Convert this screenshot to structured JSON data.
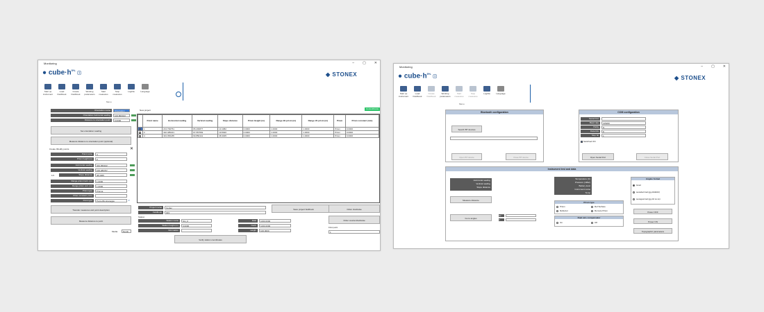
{
  "w1": {
    "title": "Monitoring",
    "logo": "cube·h",
    "logo_super": "5%",
    "brand": "STONEX",
    "ribbon": [
      {
        "label": "Start up instrument"
      },
      {
        "label": "Load Fieldbook"
      },
      {
        "label": "Create Fieldbook"
      },
      {
        "label": "Working parameters"
      },
      {
        "label": "Start measures"
      },
      {
        "label": "Stop measures"
      },
      {
        "label": "LogFile"
      },
      {
        "label": "Language"
      }
    ],
    "menu_label": "Menu",
    "left_fields": [
      {
        "label": "Orientation name",
        "value": "Orientation"
      },
      {
        "label": "Orientation horizontal reading",
        "value": "100.800013"
      },
      {
        "label": "Distance to orientation point",
        "value": "0.0000"
      }
    ],
    "set_orient_btn": "Set orientation reading",
    "measure_orient_btn": "Measure distance to orientation point (optional)",
    "create_title": "Create /Modify points",
    "point_fields": [
      {
        "label": "Point name",
        "value": "4"
      },
      {
        "label": "Prism height (m)",
        "value": "0"
      },
      {
        "label": "Horizontal reading",
        "value": "343.050102"
      },
      {
        "label": "Vertical reading",
        "value": "100.286767"
      },
      {
        "label": "Slope distance",
        "value": "38.3305"
      },
      {
        "label": "Range prism horiz. (m)",
        "value": "1.0000"
      },
      {
        "label": "Range prism vert. (m)",
        "value": "1.0000"
      },
      {
        "label": "Prism type",
        "value": "Prisma"
      },
      {
        "label": "Prism constant (mm)",
        "value": ""
      },
      {
        "label": "Point type",
        "value": "Punto/Monitoraggio"
      }
    ],
    "count_label": "1/1",
    "transfer_btn": "Transfer measures and point description",
    "measure_point_btn": "Measure distance to point",
    "media_label": "Media",
    "numb_label": "Numb",
    "project_label": "New project",
    "control_btn": "ControlPoints",
    "table_headers": [
      "Point name",
      "Horizontal reading",
      "Vertical reading",
      "Slope distance",
      "Prism Height (m)",
      "Range dH prism (m)",
      "Range dV prism (m)",
      "Prism",
      "Prism constant (mm)"
    ],
    "table_rows": [
      [
        "1",
        "213.799751",
        "95.203877",
        "10.1982",
        "0.0000",
        "1.0000",
        "1.0000",
        "Prism",
        "0.0000"
      ],
      [
        "2",
        "322.485221",
        "97.557563",
        "19.5920",
        "0.0000",
        "1.0000",
        "1.0000",
        "Prism",
        "0.0000"
      ],
      [
        "4",
        "343.050185",
        "99.856441",
        "38.3305",
        "0.0000",
        "1.0000",
        "1.0000",
        "Prism",
        "0.0000"
      ]
    ],
    "project_name_label": "Project name",
    "project_name_value": "Certec",
    "fieldbook_label": "Fieldbook",
    "fieldbook_value": "303",
    "station_title": "Station",
    "station_fields": [
      {
        "label": "Station name",
        "value": "Stn_0"
      },
      {
        "label": "Station height (m)",
        "value": "0.0000"
      },
      {
        "label": "Information",
        "value": ""
      }
    ],
    "coord_fields": [
      {
        "label": "East",
        "value": "1000.0000"
      },
      {
        "label": "North",
        "value": "1000.0000"
      },
      {
        "label": "Height",
        "value": "100.0000"
      }
    ],
    "verify_btn": "Verify station coordinates",
    "save_btn": "Save project fieldbook",
    "order_cw_btn": "Order clockwise",
    "order_ccw_btn": "Order counterclockwise",
    "first_point_label": "First point",
    "first_point_value": "1"
  },
  "w2": {
    "title": "Monitoring",
    "logo": "cube·h",
    "logo_super": "5%",
    "brand": "STONEX",
    "ribbon": [
      {
        "label": "Start up instrument",
        "dim": false
      },
      {
        "label": "Load Fieldbook",
        "dim": false
      },
      {
        "label": "Create Fieldbook",
        "dim": true
      },
      {
        "label": "Working parameters",
        "dim": false
      },
      {
        "label": "Start measures",
        "dim": true
      },
      {
        "label": "Stop measures",
        "dim": true
      },
      {
        "label": "LogFile",
        "dim": false
      },
      {
        "label": "Language",
        "dim": false
      }
    ],
    "menu_label": "Menu",
    "bt_title": "Bluetooth configuration",
    "bt_search": "Search BT devices",
    "bt_open": "Open BT device",
    "bt_close": "Close BT device",
    "com_title": "COM configuration",
    "com_fields": [
      {
        "label": "Serial Port",
        "value": ""
      },
      {
        "label": "Baud rate",
        "value": "115200"
      },
      {
        "label": "Parity",
        "value": "N"
      },
      {
        "label": "Data bits",
        "value": "8"
      },
      {
        "label": "Stop bit",
        "value": "1"
      }
    ],
    "switched_on": "Switched ON",
    "open_serial": "Open Serial Port",
    "close_serial": "Close Serial Port",
    "inst_title": "Instrument test and data",
    "reading_labels": [
      "Horizontal reading",
      "Vertical reading",
      "Slope distance"
    ],
    "instr_labels": [
      "Temperature (C)",
      "Pressure (mBar)",
      "Battery level",
      "Instrument name",
      "Temp"
    ],
    "measure_dist": "Measure distance",
    "go_angles": "Go to angles",
    "hz_label": "Hz",
    "v_label": "V",
    "prism_title": "Prism type",
    "prism_opts": [
      "Prism",
      "Ref Surface",
      "Reflector",
      "Remote Prism"
    ],
    "comp_title": "Dual axis compensator",
    "comp_opts": [
      "On",
      "Off"
    ],
    "angles_title": "Angles format",
    "angle_opts": [
      "Grad",
      "sexadecimal (gg.dddddd)",
      "sexagesimal (gg dd ss ss)"
    ],
    "power_off": "Power OFF",
    "power_on": "Power ON",
    "topo_params": "Topographic parameters"
  }
}
